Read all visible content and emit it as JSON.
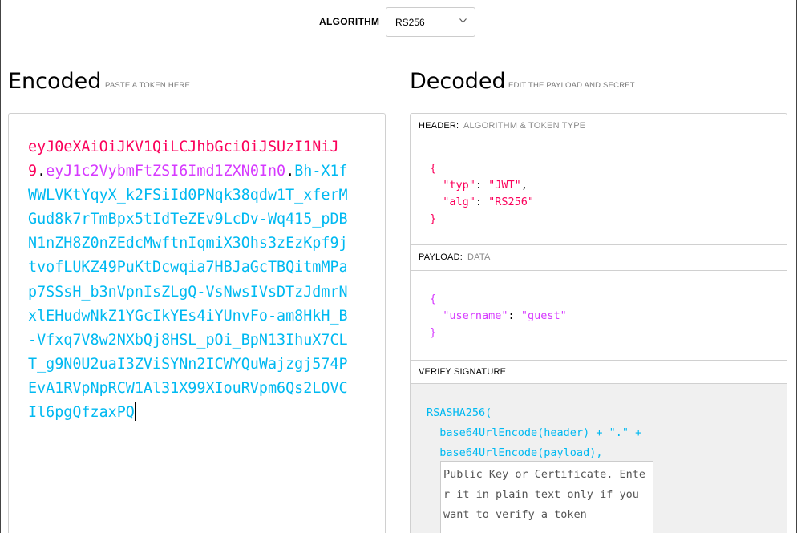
{
  "algorithm": {
    "label": "ALGORITHM",
    "selected": "RS256"
  },
  "encoded": {
    "title": "Encoded",
    "subtitle": "PASTE A TOKEN HERE",
    "token_header": "eyJ0eXAiOiJKV1QiLCJhbGciOiJSUzI1NiJ9",
    "token_payload": "eyJ1c2VybmFtZSI6Imd1ZXN0In0",
    "token_signature": "Bh-X1fWWLVKtYqyX_k2FSiId0PNqk38qdw1T_xferMGud8k7rTmBpx5tIdTeZEv9LcDv-Wq415_pDBN1nZH8Z0nZEdcMwftnIqmiX3Ohs3zEzKpf9jtvofLUKZ49PuKtDcwqia7HBJaGcTBQitmMPap7SSsH_b3nVpnIsZLgQ-VsNwsIVsDTzJdmrNxlEHudwNkZ1YGcIkYEs4iYUnvFo-am8HkH_B-Vfxq7V8w2NXbQj8HSL_pOi_BpN13IhuX7CLT_g9N0U2uaI3ZViSYNn2ICWYQuWajzgj574PEvA1RVpNpRCW1Al31X99XIouRVpm6Qs2LOVCIl6pgQfzaxPQ",
    "dot": "."
  },
  "decoded": {
    "title": "Decoded",
    "subtitle": "EDIT THE PAYLOAD AND SECRET",
    "header_section": {
      "key": "HEADER:",
      "desc": "ALGORITHM & TOKEN TYPE",
      "typ_key": "\"typ\"",
      "typ_val": "\"JWT\"",
      "alg_key": "\"alg\"",
      "alg_val": "\"RS256\""
    },
    "payload_section": {
      "key": "PAYLOAD:",
      "desc": "DATA",
      "username_key": "\"username\"",
      "username_val": "\"guest\""
    },
    "verify_section": {
      "key": "VERIFY SIGNATURE",
      "line1": "RSASHA256(",
      "line2": "  base64UrlEncode(header) + \".\" +",
      "line3": "  base64UrlEncode(payload),",
      "key_placeholder": "Public Key or Certificate. Enter it in plain text only if you want to verify a token"
    }
  },
  "colors": {
    "header": "#fb015b",
    "payload": "#d63aff",
    "signature": "#00b9f1"
  }
}
